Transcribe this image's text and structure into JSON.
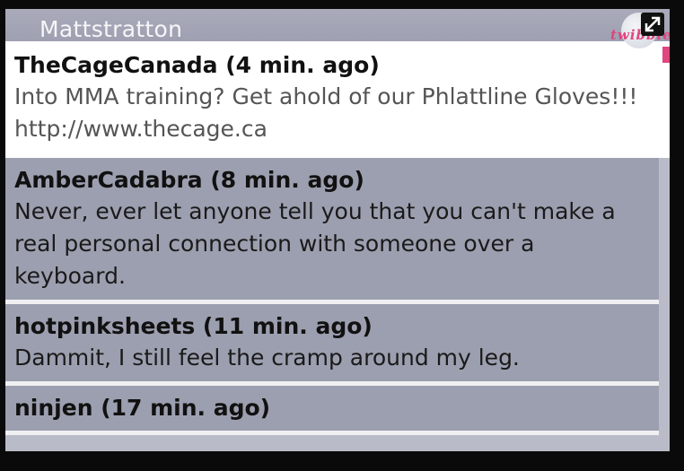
{
  "header": {
    "title": "Mattstratton",
    "logo_text": "twibble"
  },
  "icons": {
    "expand": "expand-icon"
  },
  "colors": {
    "accent": "#e0457f",
    "selected_bg": "#ffffff",
    "item_bg": "#9c9faf"
  },
  "tweets": [
    {
      "user": "TheCageCanada",
      "age": "(4 min. ago)",
      "head": "TheCageCanada (4 min. ago)",
      "text": "Into MMA training? Get ahold of our Phlattline Gloves!!! http://www.thecage.ca"
    },
    {
      "user": "AmberCadabra",
      "age": "(8 min. ago)",
      "head": "AmberCadabra (8 min. ago)",
      "text": "Never, ever let anyone tell you that you can't make a real personal connection with someone over a keyboard."
    },
    {
      "user": "hotpinksheets",
      "age": "(11 min. ago)",
      "head": "hotpinksheets (11 min. ago)",
      "text": "Dammit, I still feel the cramp around my leg."
    },
    {
      "user": "ninjen",
      "age": "(17 min. ago)",
      "head": "ninjen (17 min. ago)",
      "text": ""
    }
  ]
}
